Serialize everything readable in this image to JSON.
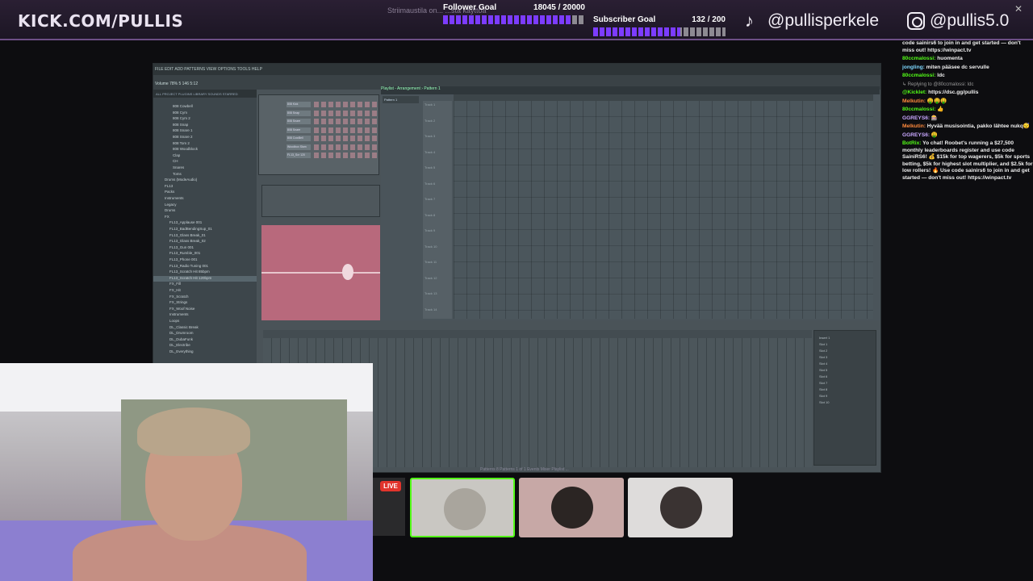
{
  "overlay": {
    "brand": "KICK.COM/PULLIS",
    "faint_text": "Striimaustila on... ...sta käyttöä",
    "follower_goal": {
      "label": "Follower Goal",
      "value": "18045 / 20000",
      "progress": 0.9
    },
    "subscriber_goal": {
      "label": "Subscriber Goal",
      "value": "132 / 200",
      "progress": 0.66
    },
    "tiktok_handle": "@pullisperkele",
    "instagram_handle": "@pullis5.0",
    "close": "✕",
    "icons": {
      "tiktok": "tiktok-icon",
      "instagram": "instagram-icon"
    },
    "colors": {
      "kick_green": "#53fc18",
      "goal_fill": "#7c3cff",
      "live_red": "#e1342c",
      "accent_border": "#6d4f86"
    }
  },
  "daw": {
    "menu": "FILE EDIT ADD PATTERNS VIEW OPTIONS TOOLS HELP",
    "hint": "Volume 78% 5 146 5:12",
    "browser_tabs": "ALL PROJECT PLUGINS LIBRARY SOUNDS STARRED",
    "browser_items": [
      "808 Cowbell",
      "808 Cym",
      "808 Cym 2",
      "808 Snap",
      "808 Snare 1",
      "808 Snare 2",
      "808 Tom 2",
      "808 Woodblock",
      "Clap",
      "CH",
      "Snares",
      "Toms",
      "Drums (ModeAudio)",
      "FL13",
      "Packs",
      "Instruments",
      "Legacy",
      "Drums",
      "FX",
      "FL13_Applause 001",
      "FL13_BadBendingSup_01",
      "FL13_Glass Break_01",
      "FL13_Glass Break_02",
      "FL13_Gun 001",
      "FL13_Rumble_001",
      "FL13_Phone 001",
      "FL13_Radio Tuning 001",
      "FL13_Scratch Hit 85bpm",
      "FL13_Scratch Hit 120bpm",
      "FX_Fill",
      "FX_Hit",
      "FX_Scratch",
      "FX_Strings",
      "FX_Woof Noise",
      "Instruments",
      "Loops",
      "DL_Classic Break",
      "DL_Drumroom",
      "DL_DubaFunk",
      "DL_Electribe",
      "DL_Everything"
    ],
    "selected_item": "FL13_Scratch Hit 120bpm",
    "channels": [
      "808 Kick",
      "808 Snap",
      "808 Snare",
      "808 Snare",
      "808 CowBell",
      "Woodbox Slam",
      "FL13_Scr 120"
    ],
    "playlist_title": "Playlist - Arrangement › Pattern 1",
    "pattern": "Pattern 1",
    "tracks": [
      "Track 1",
      "Track 2",
      "Track 3",
      "Track 4",
      "Track 5",
      "Track 6",
      "Track 7",
      "Track 8",
      "Track 9",
      "Track 10",
      "Track 11",
      "Track 12",
      "Track 13",
      "Track 14"
    ],
    "status": "Patterns   8 Patterns 1 of 1 Events    Mixer   Playlist ...",
    "mixer_right": [
      "Insert 1",
      "Slot 1",
      "Slot 2",
      "Slot 3",
      "Slot 4",
      "Slot 5",
      "Slot 6",
      "Slot 7",
      "Slot 8",
      "Slot 9",
      "Slot 10"
    ]
  },
  "chat": {
    "messages": [
      {
        "user": "",
        "text": "code sainirs6 to join in and get started — don't miss out! https://winpact.tv",
        "user_class": ""
      },
      {
        "user": "80ccmalossi:",
        "text": "huomenta",
        "user_class": "u-green"
      },
      {
        "user": "jongling:",
        "text": "miten pääsee dc servulle",
        "user_class": "u-cyan"
      },
      {
        "user": "80ccmalossi:",
        "text": "ldc",
        "user_class": "u-green"
      },
      {
        "user": "",
        "text": "↳ Replying to @80ccmalossi: ldc",
        "user_class": "reply"
      },
      {
        "user": "@Kicklet:",
        "text": "https://dsc.gg/pullis",
        "user_class": "u-green"
      },
      {
        "user": "Melkutin:",
        "text": "🤑🤑🤑",
        "user_class": "u-orange"
      },
      {
        "user": "80ccmalossi:",
        "text": "👍",
        "user_class": "u-green"
      },
      {
        "user": "GGREYS6:",
        "text": "🎰",
        "user_class": "u-purple"
      },
      {
        "user": "Melkutin:",
        "text": "Hyvää musisointia, pakko lähtee nukq😴",
        "user_class": "u-orange"
      },
      {
        "user": "GGREYS6:",
        "text": "🤑",
        "user_class": "u-purple"
      },
      {
        "user": "BotRix:",
        "text": "Yo chat! Roobet's running a $27,500 monthly leaderboards register and use code SainiRS6! 💰 $15k for top wagerers, $5k for sports betting, $5k for highest slot multiplier, and $2.5k for low rollers! 🔥 Use code sainirs6 to join in and get started — don't miss out! https://winpact.tv",
        "user_class": "u-green"
      }
    ]
  },
  "stream": {
    "live_label": "LIVE",
    "thumbnails": [
      {
        "name": "thumbnail-1",
        "active": true
      },
      {
        "name": "thumbnail-2",
        "active": false
      },
      {
        "name": "thumbnail-3",
        "active": false
      }
    ]
  }
}
